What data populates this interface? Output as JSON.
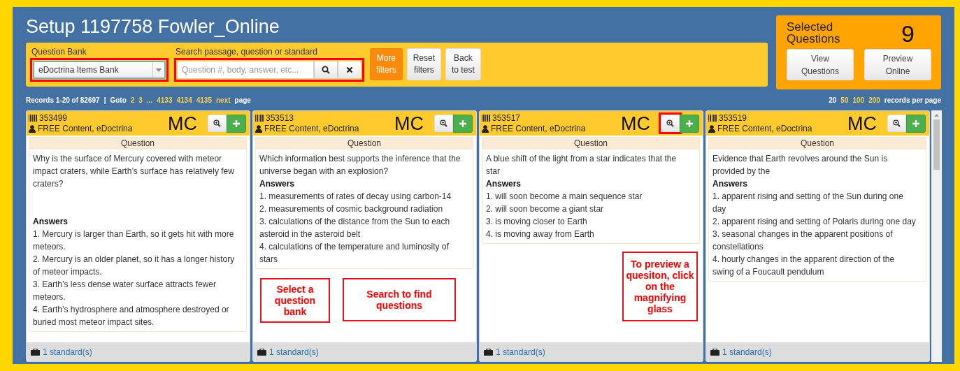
{
  "title": "Setup 1197758 Fowler_Online",
  "toolbar": {
    "bank_label": "Question Bank",
    "bank_value": "eDoctrina Items Bank",
    "bank_highlighted": true,
    "search_label": "Search passage, question or standard",
    "search_placeholder": "Question #, body, answer, etc...",
    "search_highlighted": true,
    "buttons": [
      {
        "line1": "More",
        "line2": "filters",
        "active": true
      },
      {
        "line1": "Reset",
        "line2": "filters",
        "active": false
      },
      {
        "line1": "Back",
        "line2": "to test",
        "active": false
      }
    ]
  },
  "selected_panel": {
    "label": "Selected Questions",
    "count": "9",
    "buttons": [
      {
        "line1": "View",
        "line2": "Questions"
      },
      {
        "line1": "Preview",
        "line2": "Online"
      }
    ]
  },
  "pagination": {
    "records": "Records 1-20 of 82697",
    "separator": "|",
    "goto": "Goto",
    "pages": [
      "2",
      "3",
      "...",
      "4133",
      "4134",
      "4135",
      "next"
    ],
    "page_word": "page"
  },
  "per_page": {
    "options": [
      {
        "label": "20",
        "selected": true
      },
      {
        "label": "50",
        "selected": false
      },
      {
        "label": "100",
        "selected": false
      },
      {
        "label": "200",
        "selected": false
      }
    ],
    "suffix": "records per page"
  },
  "cards": [
    {
      "id": "353499",
      "author": "FREE Content, eDoctrina",
      "type": "MC",
      "zoom_highlighted": false,
      "section": "Question",
      "question": "Why is the surface of Mercury covered with meteor impact craters, while Earth’s surface has relatively few craters?",
      "gap_after_question": true,
      "answers_label": "Answers",
      "answers": [
        "1. Mercury is larger than Earth, so it gets hit with more meteors.",
        "2. Mercury is an older planet, so it has a longer history of meteor impacts.",
        "3. Earth’s less dense water surface attracts fewer meteors.",
        "4. Earth’s hydrosphere and atmosphere destroyed or buried most meteor impact sites."
      ],
      "standards": "1 standard(s)"
    },
    {
      "id": "353513",
      "author": "FREE Content, eDoctrina",
      "type": "MC",
      "zoom_highlighted": false,
      "section": "Question",
      "question": "Which information best supports the inference that the universe began with an explosion?",
      "gap_after_question": false,
      "answers_label": "Answers",
      "answers": [
        "1. measurements of rates of decay using carbon-14",
        "2. measurements of cosmic background radiation",
        "3. calculations of the distance from the Sun to each asteroid in the asteroid belt",
        "4. calculations of the temperature and luminosity of stars"
      ],
      "standards": "1 standard(s)"
    },
    {
      "id": "353517",
      "author": "FREE Content, eDoctrina",
      "type": "MC",
      "zoom_highlighted": true,
      "section": "Question",
      "question": "A blue shift of the light from a star indicates that the star",
      "gap_after_question": false,
      "answers_label": "Answers",
      "answers": [
        "1. will soon become a main sequence star",
        "2. will soon become a giant star",
        "3. is moving closer to Earth",
        "4. is moving away from Earth"
      ],
      "standards": "1 standard(s)"
    },
    {
      "id": "353519",
      "author": "FREE Content, eDoctrina",
      "type": "MC",
      "zoom_highlighted": false,
      "section": "Question",
      "question": "Evidence that Earth revolves around the Sun is provided by the",
      "gap_after_question": false,
      "answers_label": "Answers",
      "answers": [
        "1. apparent rising and setting of the Sun during one day",
        "2. apparent rising and setting of Polaris during one day",
        "3. seasonal changes in the apparent positions of constellations",
        "4. hourly changes in the apparent direction of the swing of a Foucault pendulum"
      ],
      "standards": "1 standard(s)"
    }
  ],
  "callouts": [
    {
      "text": "Select a question bank"
    },
    {
      "text": "Search to find questions"
    },
    {
      "text": "To preview a quesiton, click on the magnifying glass"
    }
  ]
}
